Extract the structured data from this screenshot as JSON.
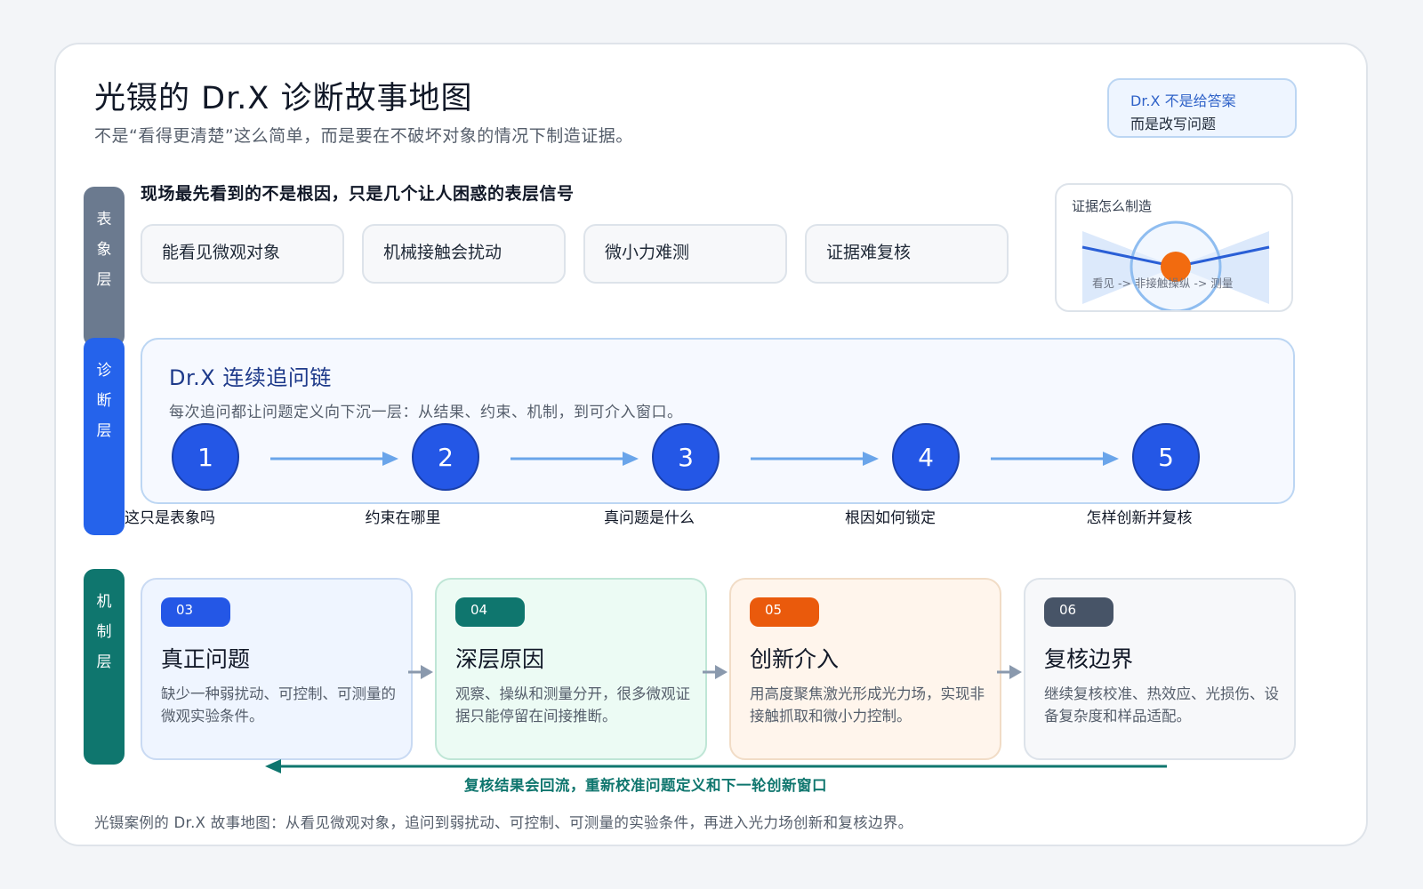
{
  "header": {
    "title": "光镊的 Dr.X 诊断故事地图",
    "subtitle": "不是“看得更清楚”这么简单，而是要在不破坏对象的情况下制造证据。"
  },
  "note": {
    "line1": "Dr.X 不是给答案",
    "line2": "而是改写问题"
  },
  "layers": [
    {
      "chars": [
        "表",
        "象",
        "层"
      ],
      "color": "#6b7a8f"
    },
    {
      "chars": [
        "诊",
        "断",
        "层"
      ],
      "color": "#2563eb"
    },
    {
      "chars": [
        "机",
        "制",
        "层"
      ],
      "color": "#0f766e"
    }
  ],
  "surface": {
    "heading": "现场最先看到的不是根因，只是几个让人困惑的表层信号",
    "signals": [
      "能看见微观对象",
      "机械接触会扰动",
      "微小力难测",
      "证据难复核"
    ]
  },
  "evidence": {
    "title": "证据怎么制造",
    "caption": "看见 -> 非接触操纵 -> 测量"
  },
  "chain": {
    "title": "Dr.X 连续追问链",
    "description": "每次追问都让问题定义向下沉一层：从结果、约束、机制，到可介入窗口。",
    "steps": [
      {
        "number": "1",
        "label": "这只是表象吗"
      },
      {
        "number": "2",
        "label": "约束在哪里"
      },
      {
        "number": "3",
        "label": "真问题是什么"
      },
      {
        "number": "4",
        "label": "根因如何锁定"
      },
      {
        "number": "5",
        "label": "怎样创新并复核"
      }
    ]
  },
  "mechanism": {
    "cards": [
      {
        "badge": "03",
        "title": "真正问题",
        "description": "缺少一种弱扰动、可控制、可测量的微观实验条件。",
        "badge_color": "#2457e6",
        "bg": "#eff5ff",
        "border": "#c9daf3"
      },
      {
        "badge": "04",
        "title": "深层原因",
        "description": "观察、操纵和测量分开，很多微观证据只能停留在间接推断。",
        "badge_color": "#0f766e",
        "bg": "#ecfbf4",
        "border": "#bfe6d6"
      },
      {
        "badge": "05",
        "title": "创新介入",
        "description": "用高度聚焦激光形成光力场，实现非接触抓取和微小力控制。",
        "badge_color": "#ea5a0c",
        "bg": "#fff5ec",
        "border": "#f1dcc6"
      },
      {
        "badge": "06",
        "title": "复核边界",
        "description": "继续复核校准、热效应、光损伤、设备复杂度和样品适配。",
        "badge_color": "#475467",
        "bg": "#f7f8fa",
        "border": "#dde3ea"
      }
    ],
    "feedback": "复核结果会回流，重新校准问题定义和下一轮创新窗口"
  },
  "footer": "光镊案例的 Dr.X 故事地图：从看见微观对象，追问到弱扰动、可控制、可测量的实验条件，再进入光力场创新和复核边界。"
}
